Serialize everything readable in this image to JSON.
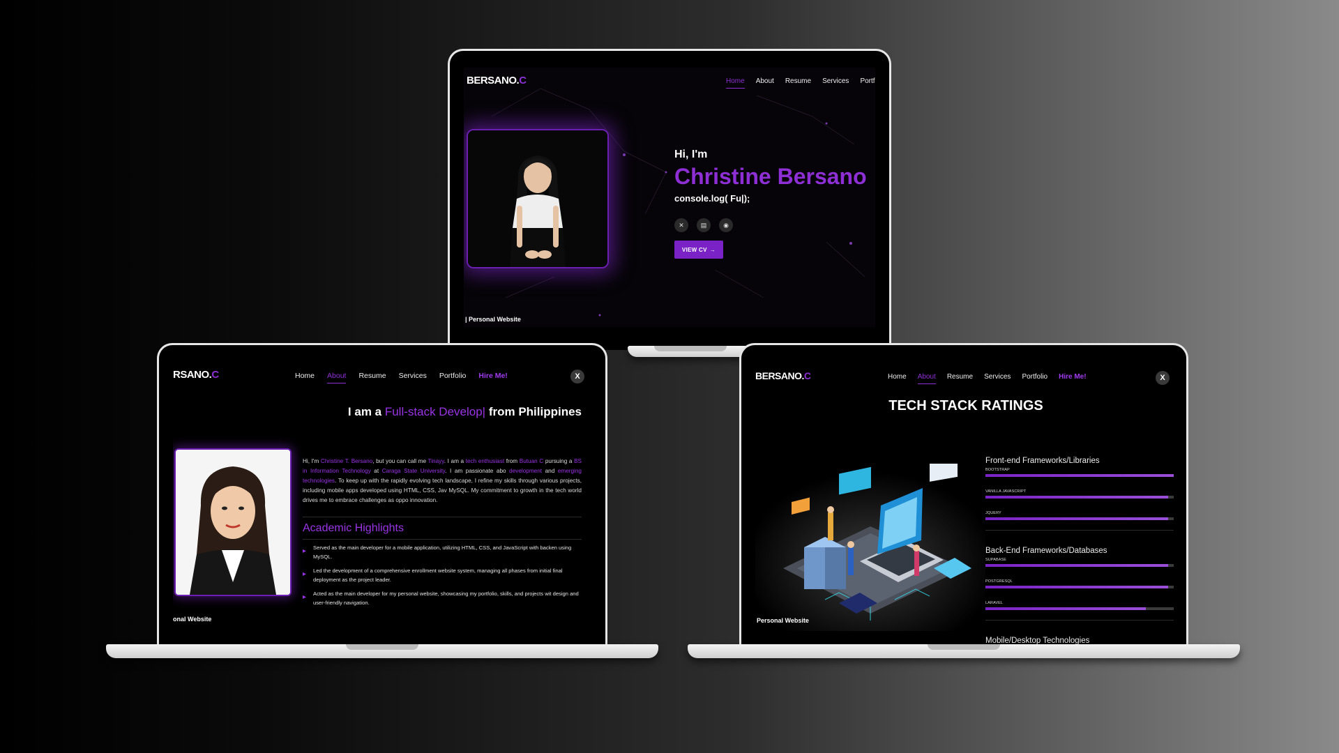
{
  "brand_main": "BERSANO.",
  "brand_accent": "C",
  "brand_cut_about": "RSANO.",
  "brand_cut_tech": "BERSANO.",
  "top": {
    "nav": [
      "Home",
      "About",
      "Resume",
      "Services",
      "Portfo"
    ],
    "greeting": "Hi, I'm",
    "name": "Christine Bersano",
    "typing": "console.log( Fu|);",
    "socials": [
      "x-icon",
      "linkedin-icon",
      "github-icon"
    ],
    "cv_label": "VIEW CV",
    "footer": "| Personal Website"
  },
  "about": {
    "nav": [
      "Home",
      "About",
      "Resume",
      "Services",
      "Portfolio",
      "Hire Me!"
    ],
    "headline_pre": "I am a ",
    "headline_role": "Full-stack Develop|",
    "headline_post": " from Philippines",
    "bio": {
      "p1": "Hi, I'm ",
      "name": "Christine T. Bersano",
      "p2": ", but you can call me ",
      "nick": "Tinayy",
      "p3": ". I am a ",
      "enth": "tech enthusiast",
      "p4": " from ",
      "city": "Butuan C",
      "p5": " pursuing a ",
      "degree": "BS in Information Technology",
      "p6": " at ",
      "uni": "Caraga State University",
      "p7": ". I am passionate abo ",
      "dev": "development",
      "p8": " and ",
      "emerging": "emerging technologies",
      "p9": ". To keep up with the rapidly evolving tech landscape, I refine my skills through various projects, including mobile apps developed using HTML, CSS, Jav MySQL. My commitment to growth in the tech world drives me to embrace challenges as oppo innovation."
    },
    "section_title": "Academic Highlights",
    "highlights": [
      "Served as the main developer for a mobile application, utilizing HTML, CSS, and JavaScript with backen using MySQL.",
      "Led the development of a comprehensive enrollment website system, managing all phases from initial final deployment as the project leader.",
      "Acted as the main developer for my personal website, showcasing my portfolio, skills, and projects wit design and user-friendly navigation."
    ],
    "footer": "onal Website",
    "close": "X"
  },
  "tech": {
    "nav": [
      "Home",
      "About",
      "Resume",
      "Services",
      "Portfolio",
      "Hire Me!"
    ],
    "title": "TECH STACK RATINGS",
    "groups": [
      {
        "title": "Front-end Frameworks/Libraries",
        "items": [
          {
            "label": "BOOTSTRAP",
            "level": 1.0
          },
          {
            "label": "VANILLA JAVASCRIPT",
            "level": 0.97
          },
          {
            "label": "JQUERY",
            "level": 0.97
          }
        ]
      },
      {
        "title": "Back-End Frameworks/Databases",
        "items": [
          {
            "label": "SUPABASE",
            "level": 0.97
          },
          {
            "label": "POSTGRESQL",
            "level": 0.97
          },
          {
            "label": "LARAVEL",
            "level": 0.85
          }
        ]
      },
      {
        "title": "Mobile/Desktop Technologies",
        "items": []
      }
    ],
    "footer": "Personal Website",
    "close": "X"
  },
  "colors": {
    "accent": "#8e2fd6",
    "accent_light": "#a13bf0",
    "screen_bg": "#050307"
  }
}
